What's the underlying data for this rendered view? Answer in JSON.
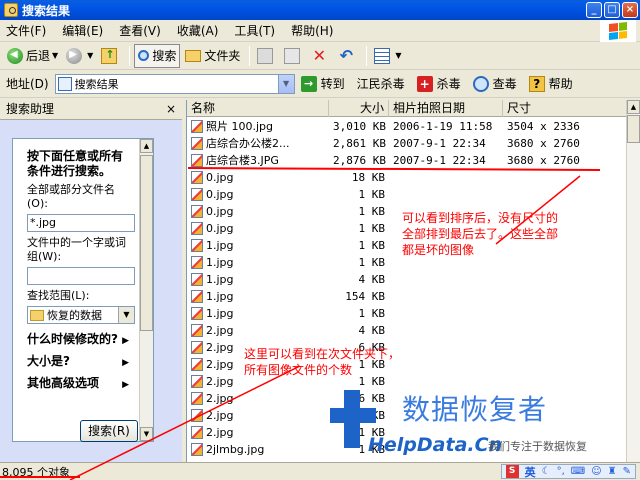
{
  "window": {
    "title": "搜索结果"
  },
  "menu": [
    "文件(F)",
    "编辑(E)",
    "查看(V)",
    "收藏(A)",
    "工具(T)",
    "帮助(H)"
  ],
  "toolbar": {
    "back_label": "后退",
    "search_label": "搜索",
    "folders_label": "文件夹"
  },
  "address": {
    "label": "地址(D)",
    "value": "搜索结果",
    "go_label": "转到",
    "plugin_label": "江民杀毒",
    "kill_label": "杀毒",
    "scan_label": "查毒",
    "help_label": "帮助"
  },
  "sidebar": {
    "title": "搜索助理",
    "close": "×",
    "heading": "按下面任意或所有条件进行搜索。",
    "filename_label": "全部或部分文件名(O):",
    "filename_value": "*.jpg",
    "phrase_label": "文件中的一个字或词组(W):",
    "phrase_value": "",
    "lookin_label": "查找范围(L):",
    "lookin_value": "恢复的数据",
    "options": [
      "什么时候修改的?",
      "大小是?",
      "其他高级选项"
    ],
    "search_button": "搜索(R)"
  },
  "columns": [
    "名称",
    "大小",
    "相片拍照日期",
    "尺寸"
  ],
  "files": [
    {
      "name": "照片 100.jpg",
      "size": "3,010 KB",
      "date": "2006-1-19 11:58",
      "dim": "3504 x 2336"
    },
    {
      "name": "店综合办公楼2...",
      "size": "2,861 KB",
      "date": "2007-9-1 22:34",
      "dim": "3680 x 2760"
    },
    {
      "name": "店综合楼3.JPG",
      "size": "2,876 KB",
      "date": "2007-9-1 22:34",
      "dim": "3680 x 2760"
    },
    {
      "name": "0.jpg",
      "size": "18 KB",
      "date": "",
      "dim": ""
    },
    {
      "name": "0.jpg",
      "size": "1 KB",
      "date": "",
      "dim": ""
    },
    {
      "name": "0.jpg",
      "size": "1 KB",
      "date": "",
      "dim": ""
    },
    {
      "name": "0.jpg",
      "size": "1 KB",
      "date": "",
      "dim": ""
    },
    {
      "name": "1.jpg",
      "size": "1 KB",
      "date": "",
      "dim": ""
    },
    {
      "name": "1.jpg",
      "size": "1 KB",
      "date": "",
      "dim": ""
    },
    {
      "name": "1.jpg",
      "size": "4 KB",
      "date": "",
      "dim": ""
    },
    {
      "name": "1.jpg",
      "size": "154 KB",
      "date": "",
      "dim": ""
    },
    {
      "name": "1.jpg",
      "size": "1 KB",
      "date": "",
      "dim": ""
    },
    {
      "name": "2.jpg",
      "size": "4 KB",
      "date": "",
      "dim": ""
    },
    {
      "name": "2.jpg",
      "size": "6 KB",
      "date": "",
      "dim": ""
    },
    {
      "name": "2.jpg",
      "size": "1 KB",
      "date": "",
      "dim": ""
    },
    {
      "name": "2.jpg",
      "size": "1 KB",
      "date": "",
      "dim": ""
    },
    {
      "name": "2.jpg",
      "size": "6 KB",
      "date": "",
      "dim": ""
    },
    {
      "name": "2.jpg",
      "size": "1 KB",
      "date": "",
      "dim": ""
    },
    {
      "name": "2.jpg",
      "size": "1 KB",
      "date": "",
      "dim": ""
    },
    {
      "name": "2jlmbg.jpg",
      "size": "1 KB",
      "date": "",
      "dim": ""
    }
  ],
  "status": {
    "count": "8,095 个对象"
  },
  "tray": {
    "ime": "英"
  },
  "annotations": {
    "sort_note": [
      "可以看到排序后，没有尺寸的",
      "全部排到最后去了。这些全部",
      "都是坏的图像"
    ],
    "count_note": [
      "这里可以看到在次文件夹下，",
      "所有图像文件的个数"
    ]
  },
  "watermark": {
    "title": "数据恢复者",
    "url": "HelpData.Cn",
    "slogan": "我们专注于数据恢复"
  },
  "colors": {
    "annotation": "#FF0000",
    "title_bar": "#0055E5",
    "watermark": "#1E63C8"
  }
}
